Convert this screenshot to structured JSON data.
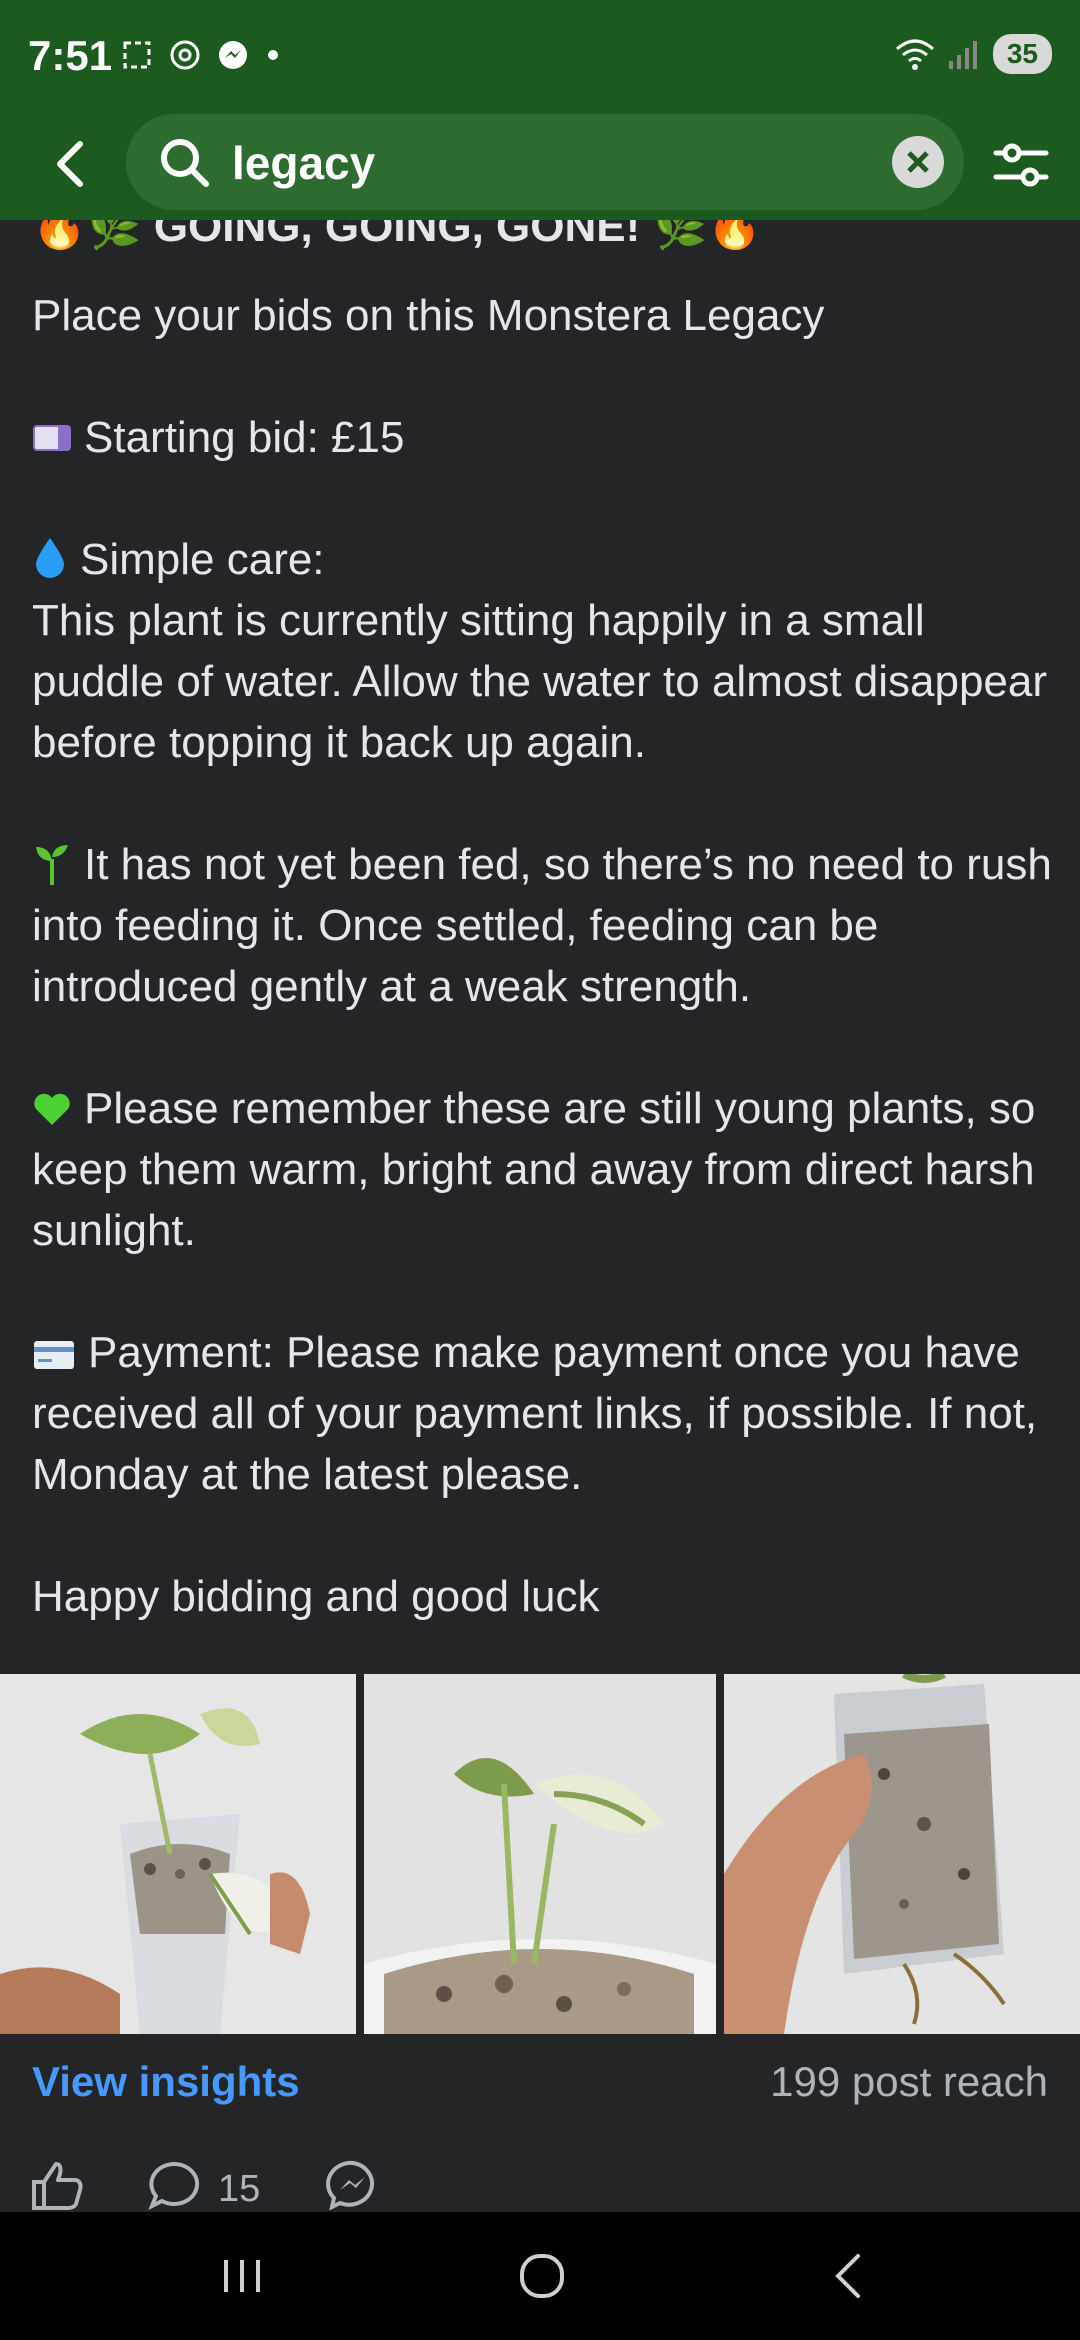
{
  "status": {
    "time": "7:51",
    "battery": "35"
  },
  "search": {
    "query": "legacy"
  },
  "post": {
    "partial_heading": "GOING, GOING, GONE!",
    "line_intro": "Place your bids on this Monstera Legacy",
    "starting_bid": "Starting bid: £15",
    "care_title": "Simple care:",
    "care_body": "This plant is currently sitting happily in a small puddle of water. Allow the water to almost disappear before topping it back up again.",
    "feeding": "It has not yet been fed, so there’s no need to rush into feeding it. Once settled, feeding can be introduced gently at a weak strength.",
    "young_plants": "Please remember these are still young plants, so keep them warm, bright and away from direct harsh sunlight.",
    "payment": "Payment: Please make payment once you have received all of your payment links, if possible. If not, Monday at the latest please.",
    "closing": "Happy bidding and good luck"
  },
  "photos": [
    "plant-photo-1",
    "plant-photo-2",
    "plant-photo-3"
  ],
  "insights": {
    "link": "View insights",
    "reach": "199 post reach"
  },
  "actions": {
    "comment_count": "15"
  },
  "icons": [
    "back-arrow-icon",
    "search-icon",
    "clear-icon",
    "filter-icon",
    "like-icon",
    "comment-icon",
    "messenger-icon"
  ],
  "colors": {
    "header": "#1d5a20",
    "background": "#242526",
    "link": "#4599ff"
  }
}
